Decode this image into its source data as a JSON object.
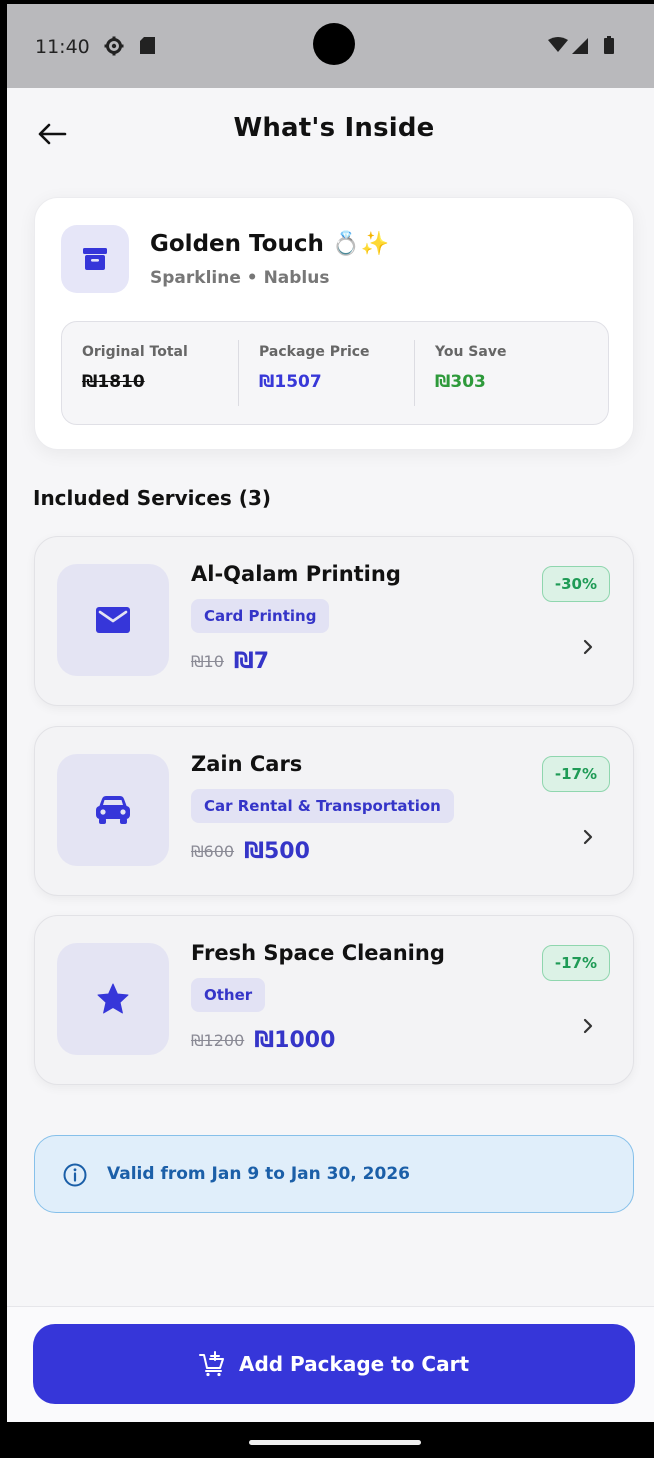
{
  "status_bar": {
    "time": "11:40"
  },
  "header": {
    "title": "What's Inside"
  },
  "package": {
    "name": "Golden Touch 💍✨",
    "subtitle": "Sparkline • Nablus",
    "original_total_label": "Original Total",
    "original_total": "₪1810",
    "package_price_label": "Package Price",
    "package_price": "₪1507",
    "you_save_label": "You Save",
    "you_save": "₪303"
  },
  "services_section": {
    "title": "Included Services (3)"
  },
  "services": [
    {
      "name": "Al-Qalam Printing",
      "category": "Card Printing",
      "old_price": "₪10",
      "new_price": "₪7",
      "discount": "-30%",
      "icon": "envelope-icon"
    },
    {
      "name": "Zain Cars",
      "category": "Car Rental & Transportation",
      "old_price": "₪600",
      "new_price": "₪500",
      "discount": "-17%",
      "icon": "car-icon"
    },
    {
      "name": "Fresh Space Cleaning",
      "category": "Other",
      "old_price": "₪1200",
      "new_price": "₪1000",
      "discount": "-17%",
      "icon": "star-icon"
    }
  ],
  "validity": {
    "text": "Valid from Jan 9 to Jan 30, 2026"
  },
  "cart_button": {
    "label": "Add Package to Cart"
  },
  "colors": {
    "accent": "#3636d9",
    "savings_green": "#2e9a3b",
    "info_blue": "#1b5fa8"
  }
}
